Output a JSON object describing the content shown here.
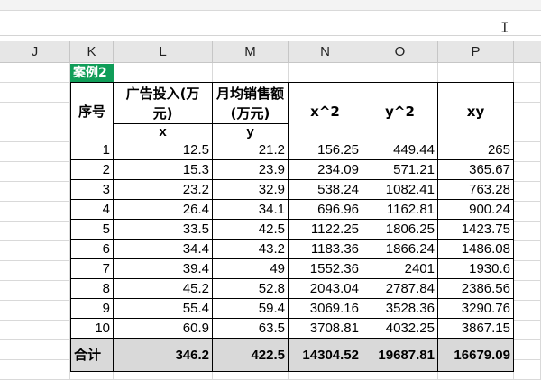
{
  "sheet": {
    "columns": [
      "J",
      "K",
      "L",
      "M",
      "N",
      "O",
      "P"
    ],
    "case_label": "案例2",
    "headers": {
      "seq": "序号",
      "x_name": "广告投入(万元)",
      "y_name": "月均销售额(万元)",
      "x2": "x^2",
      "y2": "y^2",
      "xy": "xy",
      "x_sym": "x",
      "y_sym": "y"
    },
    "rows": [
      [
        "1",
        "12.5",
        "21.2",
        "156.25",
        "449.44",
        "265"
      ],
      [
        "2",
        "15.3",
        "23.9",
        "234.09",
        "571.21",
        "365.67"
      ],
      [
        "3",
        "23.2",
        "32.9",
        "538.24",
        "1082.41",
        "763.28"
      ],
      [
        "4",
        "26.4",
        "34.1",
        "696.96",
        "1162.81",
        "900.24"
      ],
      [
        "5",
        "33.5",
        "42.5",
        "1122.25",
        "1806.25",
        "1423.75"
      ],
      [
        "6",
        "34.4",
        "43.2",
        "1183.36",
        "1866.24",
        "1486.08"
      ],
      [
        "7",
        "39.4",
        "49",
        "1552.36",
        "2401",
        "1930.6"
      ],
      [
        "8",
        "45.2",
        "52.8",
        "2043.04",
        "2787.84",
        "2386.56"
      ],
      [
        "9",
        "55.4",
        "59.4",
        "3069.16",
        "3528.36",
        "3290.76"
      ],
      [
        "10",
        "60.9",
        "63.5",
        "3708.81",
        "4032.25",
        "3867.15"
      ]
    ],
    "total": [
      "合计",
      "346.2",
      "422.5",
      "14304.52",
      "19687.81",
      "16679.09"
    ]
  },
  "icons": {
    "cursor": "text-cursor-icon"
  }
}
